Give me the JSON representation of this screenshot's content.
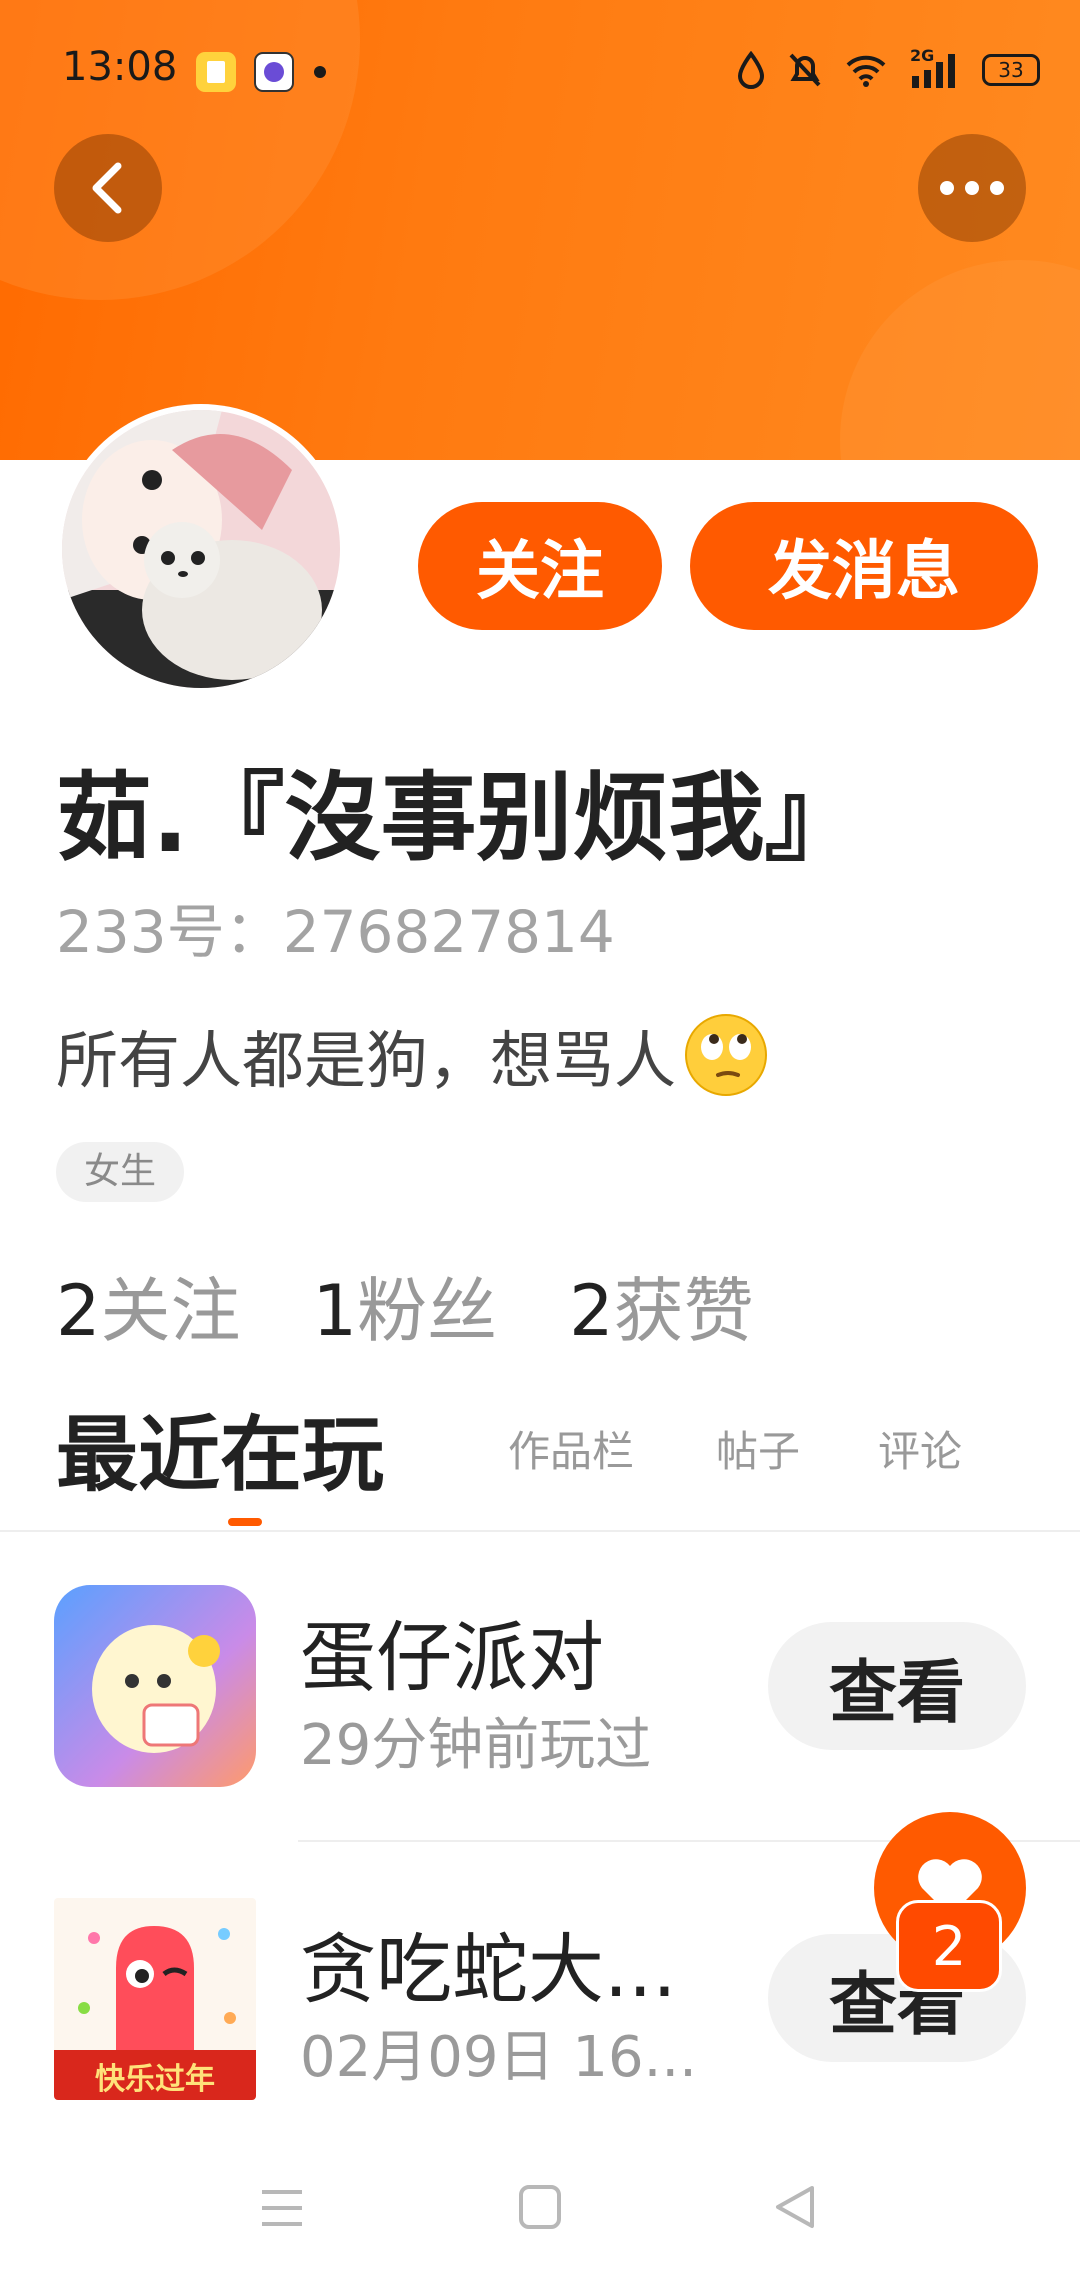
{
  "status_bar": {
    "time": "13:08",
    "battery": "33",
    "network": "2G"
  },
  "profile": {
    "follow_button": "关注",
    "message_button": "发消息",
    "name": "茹.『沒事别烦我』",
    "id_line": "233号：276827814",
    "bio": "所有人都是狗，想骂人",
    "bio_emoji": "🙄",
    "gender_tag": "女生"
  },
  "stats": [
    {
      "count": "2",
      "label": "关注"
    },
    {
      "count": "1",
      "label": "粉丝"
    },
    {
      "count": "2",
      "label": "获赞"
    }
  ],
  "tabs": {
    "active": "最近在玩",
    "items": [
      "作品栏",
      "帖子",
      "评论"
    ]
  },
  "games": [
    {
      "title": "蛋仔派对",
      "subtitle": "29分钟前玩过",
      "button": "查看"
    },
    {
      "title": "贪吃蛇大...",
      "subtitle": "02月09日 16...",
      "button": "查看",
      "icon_banner": "快乐过年"
    }
  ],
  "fab": {
    "badge": "2"
  },
  "colors": {
    "accent": "#ff5a00",
    "header": "#ff7a10"
  }
}
